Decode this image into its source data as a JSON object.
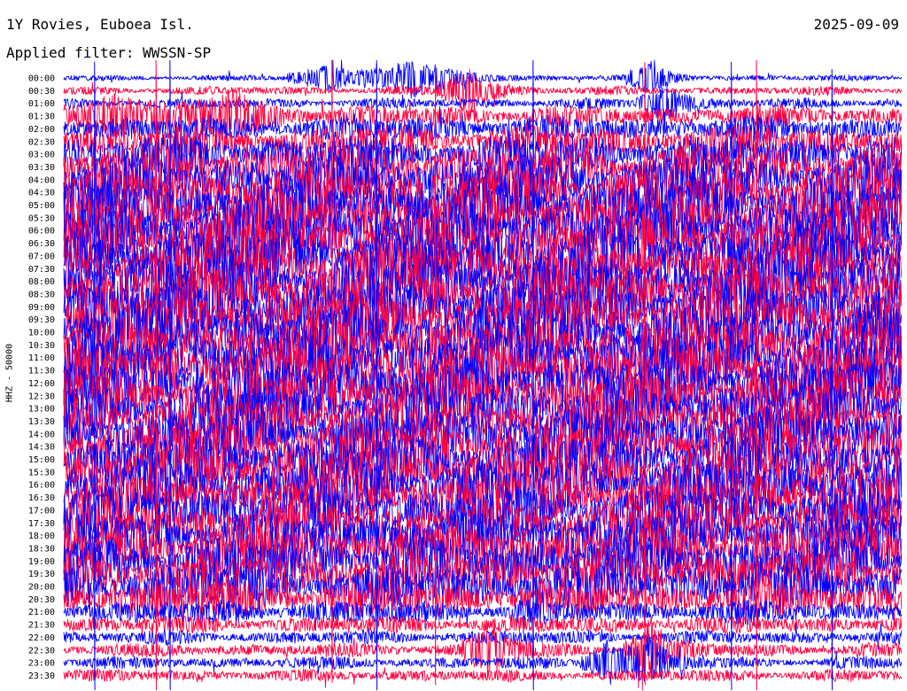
{
  "header": {
    "station": "1Y Rovies, Euboea Isl.",
    "date": "2025-09-09",
    "filter": "Applied filter: WWSSN-SP",
    "channel_label": "HHZ - 50000"
  },
  "chart_data": {
    "type": "line",
    "title": "1Y Rovies, Euboea Isl.",
    "subtitle": "Applied filter: WWSSN-SP",
    "ylabel": "HHZ - 50000",
    "row_labels": [
      "00:00",
      "00:30",
      "01:00",
      "01:30",
      "02:00",
      "02:30",
      "03:00",
      "03:30",
      "04:00",
      "04:30",
      "05:00",
      "05:30",
      "06:00",
      "06:30",
      "07:00",
      "07:30",
      "08:00",
      "08:30",
      "09:00",
      "09:30",
      "10:00",
      "10:30",
      "11:00",
      "11:30",
      "12:00",
      "12:30",
      "13:00",
      "13:30",
      "14:00",
      "14:30",
      "15:00",
      "15:30",
      "16:00",
      "16:30",
      "17:00",
      "17:30",
      "18:00",
      "18:30",
      "19:00",
      "19:30",
      "20:00",
      "20:30",
      "21:00",
      "21:30",
      "22:00",
      "22:30",
      "23:00",
      "23:30"
    ],
    "row_minutes": 30,
    "trace_colors": [
      "#0000ff",
      "#ff0040"
    ],
    "relative_amplitude": [
      0.35,
      0.5,
      0.6,
      1.2,
      1.5,
      1.9,
      2.3,
      2.6,
      2.8,
      3.0,
      3.1,
      3.2,
      3.3,
      3.3,
      3.3,
      3.3,
      3.3,
      3.3,
      3.3,
      3.3,
      3.2,
      3.2,
      3.2,
      3.2,
      3.1,
      3.0,
      3.0,
      3.0,
      3.0,
      3.0,
      3.0,
      3.0,
      3.0,
      2.9,
      2.8,
      2.8,
      2.8,
      2.8,
      2.7,
      2.7,
      2.6,
      2.2,
      1.4,
      1.0,
      0.8,
      0.8,
      0.7,
      0.7
    ],
    "events": [
      {
        "row": 0,
        "minute": 9.5,
        "strength": 2.2,
        "duration_min": 1.5
      },
      {
        "row": 0,
        "minute": 12.5,
        "strength": 3.0,
        "duration_min": 2.0
      },
      {
        "row": 0,
        "minute": 21.0,
        "strength": 2.5,
        "duration_min": 1.0
      },
      {
        "row": 1,
        "minute": 14.5,
        "strength": 3.5,
        "duration_min": 1.2
      },
      {
        "row": 2,
        "minute": 21.5,
        "strength": 3.0,
        "duration_min": 1.0
      },
      {
        "row": 3,
        "minute": 1.8,
        "strength": 3.0,
        "duration_min": 2.0
      },
      {
        "row": 3,
        "minute": 6.0,
        "strength": 2.8,
        "duration_min": 2.0
      },
      {
        "row": 45,
        "minute": 15.2,
        "strength": 4.5,
        "duration_min": 1.0
      },
      {
        "row": 45,
        "minute": 21.0,
        "strength": 4.5,
        "duration_min": 1.0
      },
      {
        "row": 46,
        "minute": 19.5,
        "strength": 3.5,
        "duration_min": 1.0
      },
      {
        "row": 46,
        "minute": 21.0,
        "strength": 3.5,
        "duration_min": 1.0
      }
    ],
    "spikes": [
      {
        "minute": 1.1,
        "up": 20,
        "down": 30
      },
      {
        "minute": 3.3,
        "up": 40,
        "down": 20
      },
      {
        "minute": 3.8,
        "up": 40,
        "down": 30
      },
      {
        "minute": 9.6,
        "up": 30,
        "down": 10
      },
      {
        "minute": 11.2,
        "up": 80,
        "down": 60
      },
      {
        "minute": 13.3,
        "up": 20,
        "down": 10
      },
      {
        "minute": 16.8,
        "up": 50,
        "down": 40
      },
      {
        "minute": 20.8,
        "up": 20,
        "down": 15
      },
      {
        "minute": 23.9,
        "up": 20,
        "down": 20
      },
      {
        "minute": 24.8,
        "up": 60,
        "down": 35
      },
      {
        "minute": 27.5,
        "up": 10,
        "down": 25
      }
    ]
  }
}
